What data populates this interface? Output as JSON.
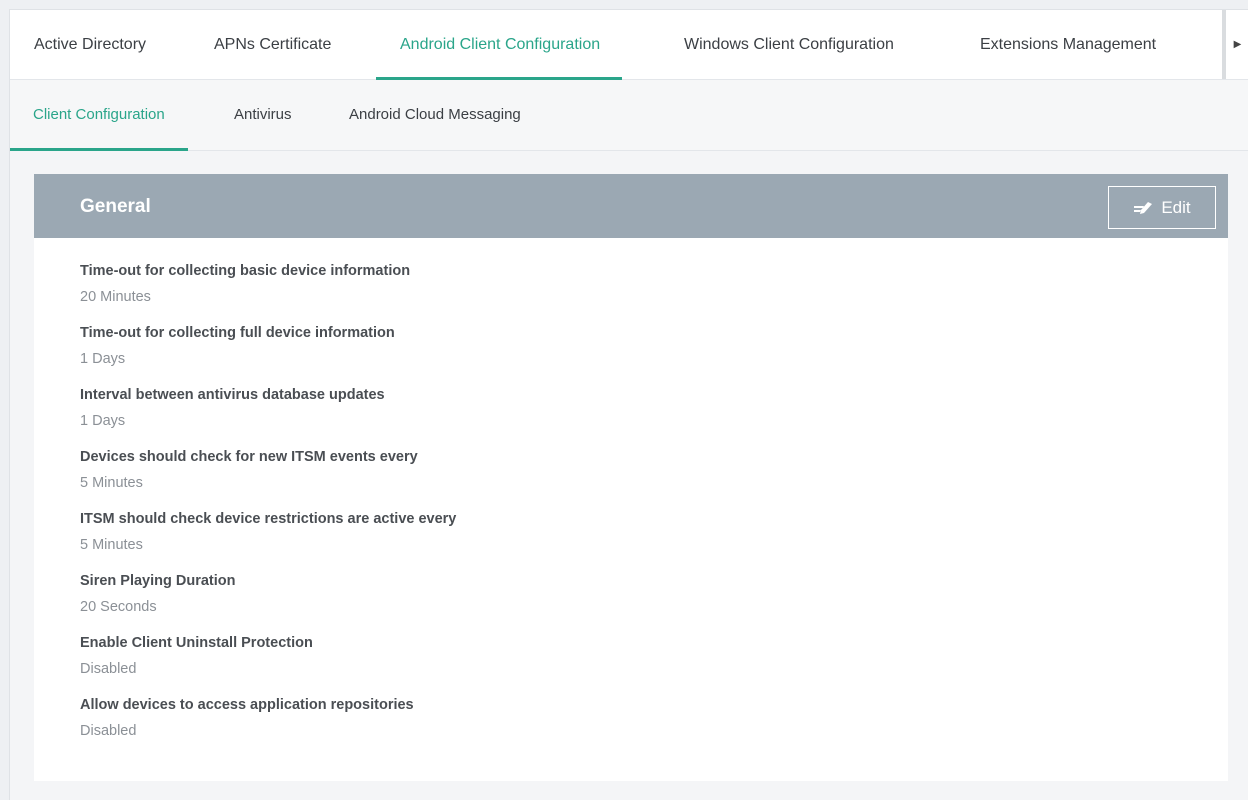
{
  "main_tabs": [
    {
      "label": "Active Directory"
    },
    {
      "label": "APNs Certificate"
    },
    {
      "label": "Android Client Configuration"
    },
    {
      "label": "Windows Client Configuration"
    },
    {
      "label": "Extensions Management"
    }
  ],
  "active_main_tab": "Android Client Configuration",
  "scroll_icon": "triangle-right-icon",
  "sub_tabs": [
    {
      "label": "Client Configuration"
    },
    {
      "label": "Antivirus"
    },
    {
      "label": "Android Cloud Messaging"
    }
  ],
  "active_sub_tab": "Client Configuration",
  "section": {
    "title": "General",
    "edit_label": "Edit",
    "edit_icon": "pencil-edit-icon"
  },
  "fields": [
    {
      "label": "Time-out for collecting basic device information",
      "value": "20 Minutes"
    },
    {
      "label": "Time-out for collecting full device information",
      "value": "1 Days"
    },
    {
      "label": "Interval between antivirus database updates",
      "value": "1 Days"
    },
    {
      "label": "Devices should check for new ITSM events every",
      "value": "5 Minutes"
    },
    {
      "label": "ITSM should check device restrictions are active every",
      "value": "5 Minutes"
    },
    {
      "label": "Siren Playing Duration",
      "value": "20 Seconds"
    },
    {
      "label": "Enable Client Uninstall Protection",
      "value": "Disabled"
    },
    {
      "label": "Allow devices to access application repositories",
      "value": "Disabled"
    }
  ],
  "colors": {
    "accent": "#2aa58a",
    "header_bg": "#9ba8b3",
    "page_bg": "#f4f5f7"
  }
}
